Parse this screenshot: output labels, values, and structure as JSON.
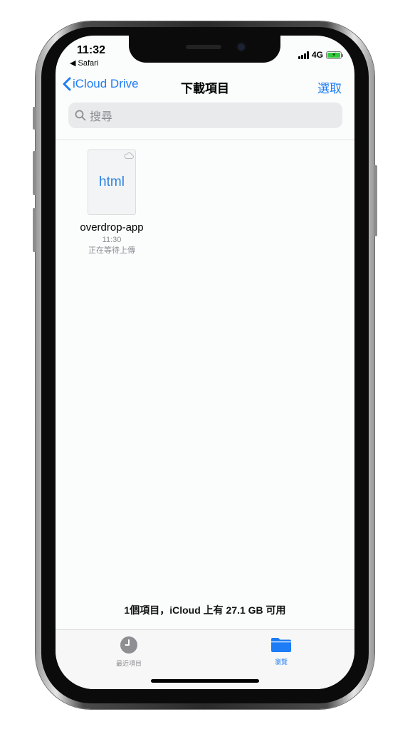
{
  "status_bar": {
    "time": "11:32",
    "back_app": "◀ Safari",
    "network": "4G"
  },
  "nav": {
    "back_label": "iCloud Drive",
    "title": "下載項目",
    "select_label": "選取"
  },
  "search": {
    "placeholder": "搜尋"
  },
  "files": [
    {
      "type_label": "html",
      "name": "overdrop-app",
      "time": "11:30",
      "status": "正在等待上傳"
    }
  ],
  "storage_summary": "1個項目，iCloud 上有 27.1 GB 可用",
  "tabs": [
    {
      "label": "最近項目",
      "icon": "clock-icon",
      "active": false
    },
    {
      "label": "瀏覽",
      "icon": "folder-icon",
      "active": true
    }
  ],
  "colors": {
    "accent": "#1d7cf6",
    "inactive_tab": "#8e8e93",
    "battery_fill": "#32c93a"
  }
}
